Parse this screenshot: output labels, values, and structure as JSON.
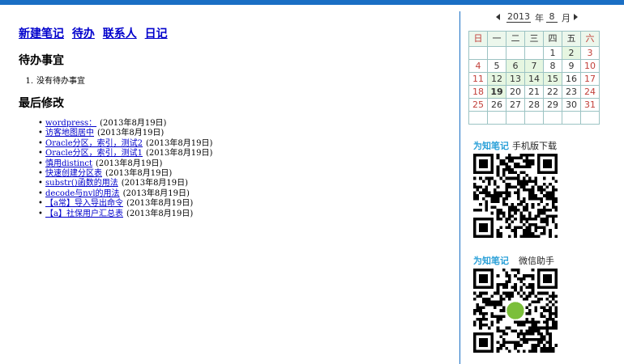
{
  "nav": {
    "links": [
      "新建笔记",
      "待办",
      "联系人",
      "日记"
    ]
  },
  "todo": {
    "heading": "待办事宜",
    "items": [
      {
        "num": "1.",
        "text": "没有待办事宜"
      }
    ]
  },
  "recent": {
    "heading": "最后修改",
    "bullet": "•",
    "items": [
      {
        "title": "wordpress：",
        "date": "(2013年8月19日)"
      },
      {
        "title": "访客地图居中",
        "date": "(2013年8月19日)"
      },
      {
        "title": "Oracle分区，索引，测试2",
        "date": "(2013年8月19日)"
      },
      {
        "title": "Oracle分区，索引，测试1",
        "date": "(2013年8月19日)"
      },
      {
        "title": "慎用distinct",
        "date": "(2013年8月19日)"
      },
      {
        "title": "快速创建分区表",
        "date": "(2013年8月19日)"
      },
      {
        "title": "substr()函数的用法",
        "date": "(2013年8月19日)"
      },
      {
        "title": "decode与nvl的用法",
        "date": "(2013年8月19日)"
      },
      {
        "title": "【a常】导入导出命令",
        "date": "(2013年8月19日)"
      },
      {
        "title": "【a】社保用户汇总表",
        "date": "(2013年8月19日)"
      }
    ]
  },
  "calendar": {
    "year": "2013",
    "year_label": "年",
    "month": "8",
    "month_label": "月",
    "weekdays": [
      "日",
      "一",
      "二",
      "三",
      "四",
      "五",
      "六"
    ],
    "weeks": [
      [
        "",
        "",
        "",
        "",
        "1",
        "2",
        "3"
      ],
      [
        "4",
        "5",
        "6",
        "7",
        "8",
        "9",
        "10"
      ],
      [
        "11",
        "12",
        "13",
        "14",
        "15",
        "16",
        "17"
      ],
      [
        "18",
        "19",
        "20",
        "21",
        "22",
        "23",
        "24"
      ],
      [
        "25",
        "26",
        "27",
        "28",
        "29",
        "30",
        "31"
      ],
      [
        "",
        "",
        "",
        "",
        "",
        "",
        ""
      ]
    ],
    "note_days": [
      "2",
      "6",
      "7",
      "12",
      "13",
      "14",
      "15",
      "19"
    ],
    "today": "19",
    "prev_icon": "triangle-left-icon",
    "next_icon": "triangle-right-icon"
  },
  "promo_mobile": {
    "brand": "为知笔记",
    "text": "手机版下载"
  },
  "promo_wechat": {
    "brand": "为知笔记",
    "text": "微信助手"
  },
  "colors": {
    "accent": "#1a6fc4",
    "link": "#0000cc",
    "weekend": "#c2413b",
    "brand": "#2aa0d8",
    "note_cell": "#e6f6e1"
  }
}
